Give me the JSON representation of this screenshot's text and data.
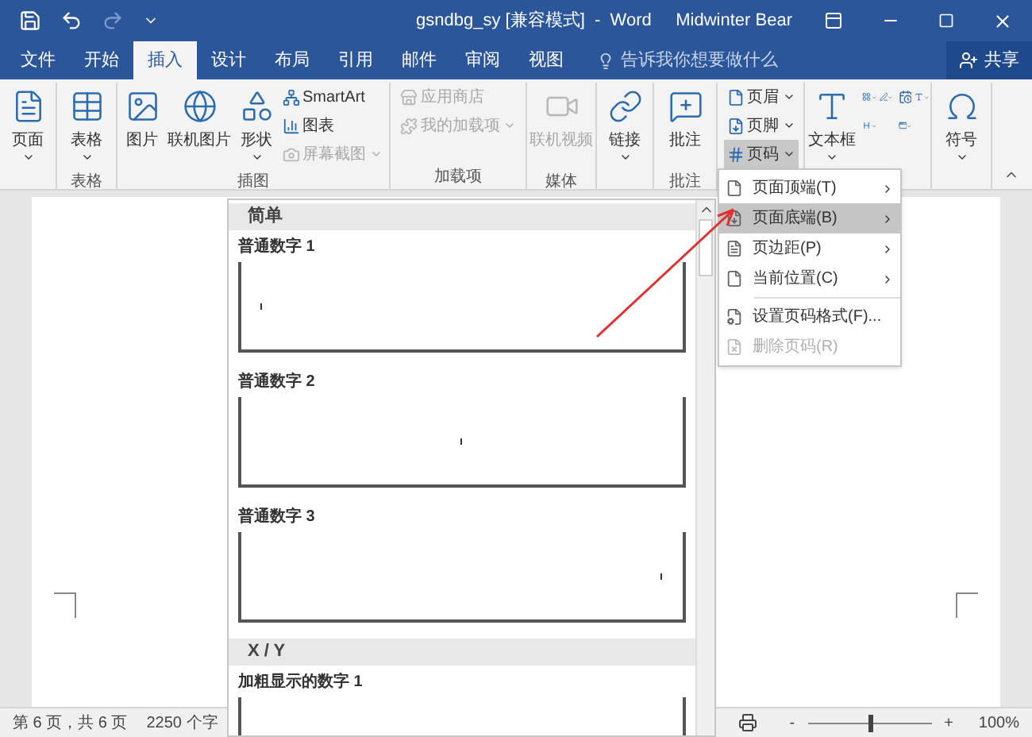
{
  "window": {
    "title": "gsndbg_sy [兼容模式]  -  Word",
    "user": "Midwinter Bear"
  },
  "quick_access": [
    {
      "kind": "save",
      "disabled": false
    },
    {
      "kind": "undo",
      "disabled": false
    },
    {
      "kind": "redo",
      "disabled": true
    },
    {
      "kind": "customize",
      "disabled": false
    }
  ],
  "tabs": [
    {
      "label": "文件",
      "selected": false
    },
    {
      "label": "开始",
      "selected": false
    },
    {
      "label": "插入",
      "selected": true
    },
    {
      "label": "设计",
      "selected": false
    },
    {
      "label": "布局",
      "selected": false
    },
    {
      "label": "引用",
      "selected": false
    },
    {
      "label": "邮件",
      "selected": false
    },
    {
      "label": "审阅",
      "selected": false
    },
    {
      "label": "视图",
      "selected": false
    }
  ],
  "tell_me": {
    "placeholder": "告诉我你想要做什么"
  },
  "share": "共享",
  "ribbon_groups": [
    {
      "items": [
        {
          "kind": "large",
          "label": "页面",
          "disabled": false,
          "selected": false
        }
      ]
    },
    {
      "label": "表格",
      "items": [
        {
          "kind": "large",
          "label": "表格",
          "disabled": false,
          "selected": false
        }
      ]
    },
    {
      "label": "插图",
      "items": [
        {
          "kind": "large",
          "label": "图片",
          "disabled": false,
          "selected": false
        },
        {
          "kind": "large",
          "label": "联机图片",
          "disabled": false,
          "selected": false
        },
        {
          "kind": "large",
          "label": "形状",
          "disabled": false,
          "selected": false
        },
        {
          "kind": "small",
          "label": "SmartArt",
          "disabled": false,
          "selected": false
        },
        {
          "kind": "small",
          "label": "图表",
          "disabled": false,
          "selected": false
        },
        {
          "kind": "small",
          "label": "屏幕截图",
          "disabled": true,
          "selected": false
        }
      ]
    },
    {
      "label": "加载项",
      "items": [
        {
          "kind": "small",
          "label": "应用商店",
          "disabled": true,
          "selected": false
        },
        {
          "kind": "small",
          "label": "我的加载项",
          "disabled": true,
          "selected": false
        }
      ]
    },
    {
      "label": "媒体",
      "items": [
        {
          "kind": "large",
          "label": "联机视频",
          "disabled": true,
          "selected": false
        }
      ]
    },
    {
      "items": [
        {
          "kind": "large",
          "label": "链接",
          "disabled": false,
          "selected": false
        }
      ]
    },
    {
      "label": "批注",
      "items": [
        {
          "kind": "large",
          "label": "批注",
          "disabled": false,
          "selected": false
        }
      ]
    },
    {
      "items": [
        {
          "kind": "small",
          "label": "页眉",
          "disabled": false,
          "selected": false
        },
        {
          "kind": "small",
          "label": "页脚",
          "disabled": false,
          "selected": false
        },
        {
          "kind": "small",
          "label": "页码",
          "disabled": false,
          "selected": true
        }
      ]
    },
    {
      "items": [
        {
          "kind": "large",
          "label": "文本框",
          "disabled": false,
          "selected": false
        },
        {
          "kind": "icon",
          "disabled": false,
          "selected": false
        },
        {
          "kind": "icon",
          "disabled": false,
          "selected": false
        },
        {
          "kind": "icon",
          "disabled": false,
          "selected": false
        },
        {
          "kind": "icon",
          "disabled": false,
          "selected": false
        },
        {
          "kind": "icon",
          "disabled": false,
          "selected": false
        },
        {
          "kind": "icon",
          "disabled": false,
          "selected": false
        }
      ]
    },
    {
      "items": [
        {
          "kind": "large",
          "label": "符号",
          "disabled": false,
          "selected": false
        }
      ]
    }
  ],
  "page_number_menu": [
    {
      "label": "页面顶端(T)",
      "submenu": true,
      "selected": false,
      "disabled": false
    },
    {
      "label": "页面底端(B)",
      "submenu": true,
      "selected": true,
      "disabled": false
    },
    {
      "label": "页边距(P)",
      "submenu": true,
      "selected": false,
      "disabled": false
    },
    {
      "label": "当前位置(C)",
      "submenu": true,
      "selected": false,
      "disabled": false
    },
    {
      "label": "设置页码格式(F)...",
      "submenu": false,
      "selected": false,
      "disabled": false
    },
    {
      "label": "删除页码(R)",
      "submenu": false,
      "selected": false,
      "disabled": true
    }
  ],
  "gallery": [
    {
      "header": "简单",
      "items": [
        {
          "label": "普通数字 1"
        },
        {
          "label": "普通数字 2"
        },
        {
          "label": "普通数字 3"
        }
      ]
    },
    {
      "header": "X / Y",
      "items": [
        {
          "label": "加粗显示的数字 1"
        }
      ]
    }
  ],
  "status_bar": {
    "page_info": "第 6 页，共 6 页",
    "word_count": "2250 个字",
    "zoom": {
      "minus": "-",
      "plus": "+",
      "level": 0.5,
      "reading": "100%"
    }
  }
}
